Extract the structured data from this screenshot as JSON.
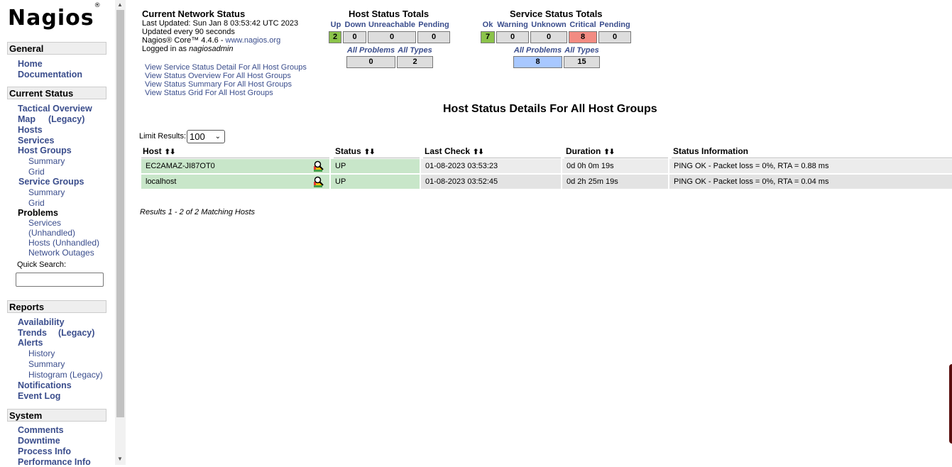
{
  "logo": "Nagios",
  "sidebar": {
    "general": {
      "heading": "General",
      "items": [
        "Home",
        "Documentation"
      ]
    },
    "current_status": {
      "heading": "Current Status",
      "tactical": "Tactical Overview",
      "map": "Map",
      "map_legacy": "(Legacy)",
      "hosts": "Hosts",
      "services": "Services",
      "host_groups": "Host Groups",
      "hg_summary": "Summary",
      "hg_grid": "Grid",
      "service_groups": "Service Groups",
      "sg_summary": "Summary",
      "sg_grid": "Grid",
      "problems": "Problems",
      "pb_services": "Services",
      "pb_unhandled": "(Unhandled)",
      "pb_hosts": "Hosts (Unhandled)",
      "pb_outages": "Network Outages",
      "quick_search": "Quick Search:"
    },
    "reports": {
      "heading": "Reports",
      "availability": "Availability",
      "trends": "Trends",
      "trends_legacy": "(Legacy)",
      "alerts": "Alerts",
      "history": "History",
      "summary": "Summary",
      "histogram": "Histogram (Legacy)",
      "notifications": "Notifications",
      "event_log": "Event Log"
    },
    "system": {
      "heading": "System",
      "comments": "Comments",
      "downtime": "Downtime",
      "process_info": "Process Info",
      "performance_info": "Performance Info"
    }
  },
  "network_status": {
    "title": "Current Network Status",
    "last_updated": "Last Updated: Sun Jan 8 03:53:42 UTC 2023",
    "interval": "Updated every 90 seconds",
    "core_prefix": "Nagios® Core™ 4.4.6 - ",
    "core_link": "www.nagios.org",
    "logged_prefix": "Logged in as ",
    "user": "nagiosadmin",
    "links": [
      "View Service Status Detail For All Host Groups",
      "View Status Overview For All Host Groups",
      "View Status Summary For All Host Groups",
      "View Status Grid For All Host Groups"
    ]
  },
  "host_totals": {
    "title": "Host Status Totals",
    "labels": [
      "Up",
      "Down",
      "Unreachable",
      "Pending"
    ],
    "values": [
      "2",
      "0",
      "0",
      "0"
    ],
    "sub_labels": [
      "All Problems",
      "All Types"
    ],
    "sub_values": [
      "0",
      "2"
    ]
  },
  "service_totals": {
    "title": "Service Status Totals",
    "labels": [
      "Ok",
      "Warning",
      "Unknown",
      "Critical",
      "Pending"
    ],
    "values": [
      "7",
      "0",
      "0",
      "8",
      "0"
    ],
    "sub_labels": [
      "All Problems",
      "All Types"
    ],
    "sub_values": [
      "8",
      "15"
    ]
  },
  "colors": {
    "up": "#8bc34a",
    "critical": "#f28b82",
    "problems": "#a8c8ff",
    "row_green": "#c8e6c9"
  },
  "main_title": "Host Status Details For All Host Groups",
  "limit": {
    "label": "Limit Results:",
    "value": "100"
  },
  "table": {
    "headers": [
      "Host",
      "Status",
      "Last Check",
      "Duration",
      "Status Information"
    ],
    "rows": [
      {
        "host": "EC2AMAZ-JI87OT0",
        "status": "UP",
        "last_check": "01-08-2023 03:53:23",
        "duration": "0d 0h 0m 19s",
        "info": "PING OK - Packet loss = 0%, RTA = 0.88 ms"
      },
      {
        "host": "localhost",
        "status": "UP",
        "last_check": "01-08-2023 03:52:45",
        "duration": "0d 2h 25m 19s",
        "info": "PING OK - Packet loss = 0%, RTA = 0.04 ms"
      }
    ]
  },
  "results_text": "Results 1 - 2 of 2 Matching Hosts"
}
